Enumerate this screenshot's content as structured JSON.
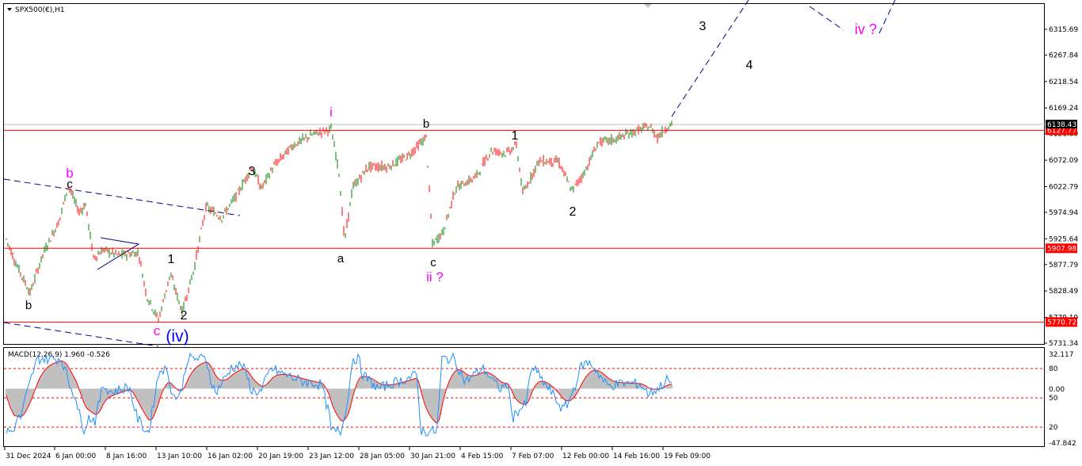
{
  "chart_data": [
    {
      "type": "candlestick",
      "title": "SPX500(€),H1",
      "symbol_label": "SPX500(€),H1",
      "y_ticks": [
        "6315.69",
        "6267.84",
        "6218.54",
        "6169.24",
        "6121.39",
        "6072.09",
        "6022.79",
        "5974.94",
        "5925.64",
        "5877.79",
        "5828.49",
        "5779.19",
        "5731.34"
      ],
      "ylim": [
        5731.34,
        6315.69
      ],
      "horizontal_levels": [
        {
          "label": "6127.77",
          "value": 6127.77
        },
        {
          "label": "5907.98",
          "value": 5907.98
        },
        {
          "label": "5770.72",
          "value": 5770.72
        }
      ],
      "current_price": {
        "label": "6138.43",
        "value": 6138.43
      },
      "wave_labels": [
        {
          "text": "b",
          "color": "#000000"
        },
        {
          "text": "b",
          "color": "#ff00ff"
        },
        {
          "text": "c",
          "color": "#000000"
        },
        {
          "text": "c",
          "color": "#ff00ff"
        },
        {
          "text": "(iv)",
          "color": "#0000ff"
        },
        {
          "text": "1",
          "color": "#000000"
        },
        {
          "text": "2",
          "color": "#000000"
        },
        {
          "text": "3",
          "color": "#000000"
        },
        {
          "text": "i",
          "color": "#ff00ff"
        },
        {
          "text": "a",
          "color": "#000000"
        },
        {
          "text": "b",
          "color": "#000000"
        },
        {
          "text": "c",
          "color": "#000000"
        },
        {
          "text": "ii ?",
          "color": "#ff00ff"
        },
        {
          "text": "1",
          "color": "#000000"
        },
        {
          "text": "2",
          "color": "#000000"
        },
        {
          "text": "3",
          "color": "#000000"
        },
        {
          "text": "4",
          "color": "#000000"
        },
        {
          "text": "iv ?",
          "color": "#ff00ff"
        }
      ],
      "x_ticks": [
        "31 Dec 2024",
        "6 Jan 00:00",
        "8 Jan 16:00",
        "13 Jan 10:00",
        "16 Jan 02:00",
        "20 Jan 19:00",
        "23 Jan 12:00",
        "28 Jan 05:00",
        "30 Jan 21:00",
        "4 Feb 15:00",
        "7 Feb 07:00",
        "12 Feb 00:00",
        "14 Feb 16:00",
        "19 Feb 09:00"
      ],
      "price_path": [
        [
          "31 Dec 2024",
          5925
        ],
        [
          "6 Jan 00:00",
          6025
        ],
        [
          "8 Jan 16:00",
          5900
        ],
        [
          "13 Jan 10:00",
          5775
        ],
        [
          "16 Jan 02:00",
          5985
        ],
        [
          "20 Jan 19:00",
          6060
        ],
        [
          "23 Jan 12:00",
          6130
        ],
        [
          "28 Jan 05:00",
          5920
        ],
        [
          "30 Jan 21:00",
          5915
        ],
        [
          "4 Feb 15:00",
          6070
        ],
        [
          "7 Feb 07:00",
          6030
        ],
        [
          "12 Feb 00:00",
          6015
        ],
        [
          "14 Feb 16:00",
          6125
        ],
        [
          "19 Feb 09:00",
          6138
        ]
      ],
      "colors": {
        "up": "#008000",
        "down": "#ff0000",
        "level": "#ff0000",
        "trend": "#00008b",
        "price_tag": "#000000"
      }
    },
    {
      "type": "line",
      "title": "MACD(12,26,9) 1.960 -0.526",
      "header_label": "MACD(12,26,9) 1.960 -0.526",
      "y_ticks": [
        "32.117",
        "80",
        "0.00",
        "50",
        "20",
        "-47.842"
      ],
      "levels": [
        {
          "label": "80",
          "value": 80
        },
        {
          "label": "50",
          "value": 50
        },
        {
          "label": "20",
          "value": 20
        }
      ],
      "colors": {
        "histogram": "#c0c0c0",
        "signal": "#ff0000",
        "line": "#1e90ff",
        "level": "#ff0000"
      }
    }
  ]
}
